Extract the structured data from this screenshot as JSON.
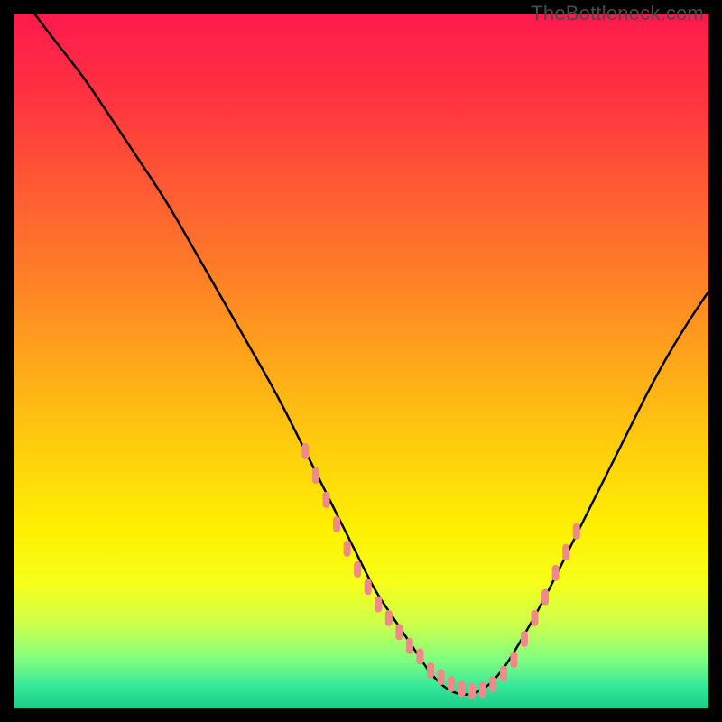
{
  "watermark": "TheBottleneck.com",
  "chart_data": {
    "type": "line",
    "title": "",
    "xlabel": "",
    "ylabel": "",
    "xlim": [
      0,
      100
    ],
    "ylim": [
      0,
      100
    ],
    "background_gradient": {
      "stops": [
        {
          "offset": 0.0,
          "color": "#ff1a4d"
        },
        {
          "offset": 0.12,
          "color": "#ff3340"
        },
        {
          "offset": 0.25,
          "color": "#ff5a33"
        },
        {
          "offset": 0.38,
          "color": "#ff8026"
        },
        {
          "offset": 0.5,
          "color": "#ffa61a"
        },
        {
          "offset": 0.62,
          "color": "#ffcc0d"
        },
        {
          "offset": 0.74,
          "color": "#fff000"
        },
        {
          "offset": 0.82,
          "color": "#f5ff1a"
        },
        {
          "offset": 0.88,
          "color": "#ccff4d"
        },
        {
          "offset": 0.93,
          "color": "#80ff80"
        },
        {
          "offset": 0.97,
          "color": "#33e699"
        },
        {
          "offset": 1.0,
          "color": "#1acc88"
        }
      ]
    },
    "series": [
      {
        "name": "bottleneck-curve",
        "x": [
          3,
          6,
          10,
          14,
          18,
          22,
          26,
          30,
          34,
          38,
          42,
          46,
          50,
          52,
          54,
          56,
          58,
          60,
          62,
          64,
          66,
          68,
          70,
          72,
          76,
          80,
          84,
          88,
          92,
          96,
          100
        ],
        "y": [
          100,
          96,
          91,
          85,
          79,
          73,
          66,
          59,
          52,
          45,
          37,
          29,
          21,
          17,
          14,
          11,
          8,
          5,
          3,
          2,
          2,
          3,
          5,
          8,
          15,
          23,
          31,
          39,
          47,
          54,
          60
        ]
      }
    ],
    "highlight_band": {
      "name": "scatter-overlay",
      "color": "#f08a8a",
      "points_x": [
        42,
        43.5,
        45,
        46.5,
        48,
        49.5,
        51,
        52.5,
        54,
        55.5,
        57,
        58.5,
        60,
        61.5,
        63,
        64.5,
        66,
        67.5,
        69,
        70.5,
        72,
        73.5,
        75,
        76.5,
        78,
        79.5,
        81
      ],
      "points_y": [
        37,
        33.5,
        30,
        26.5,
        23,
        20,
        17.5,
        15,
        13,
        11,
        9,
        7.5,
        5.5,
        4.5,
        3.5,
        2.8,
        2.5,
        2.7,
        3.5,
        5,
        7,
        10,
        13,
        16,
        19.5,
        22.5,
        25.5
      ]
    }
  }
}
